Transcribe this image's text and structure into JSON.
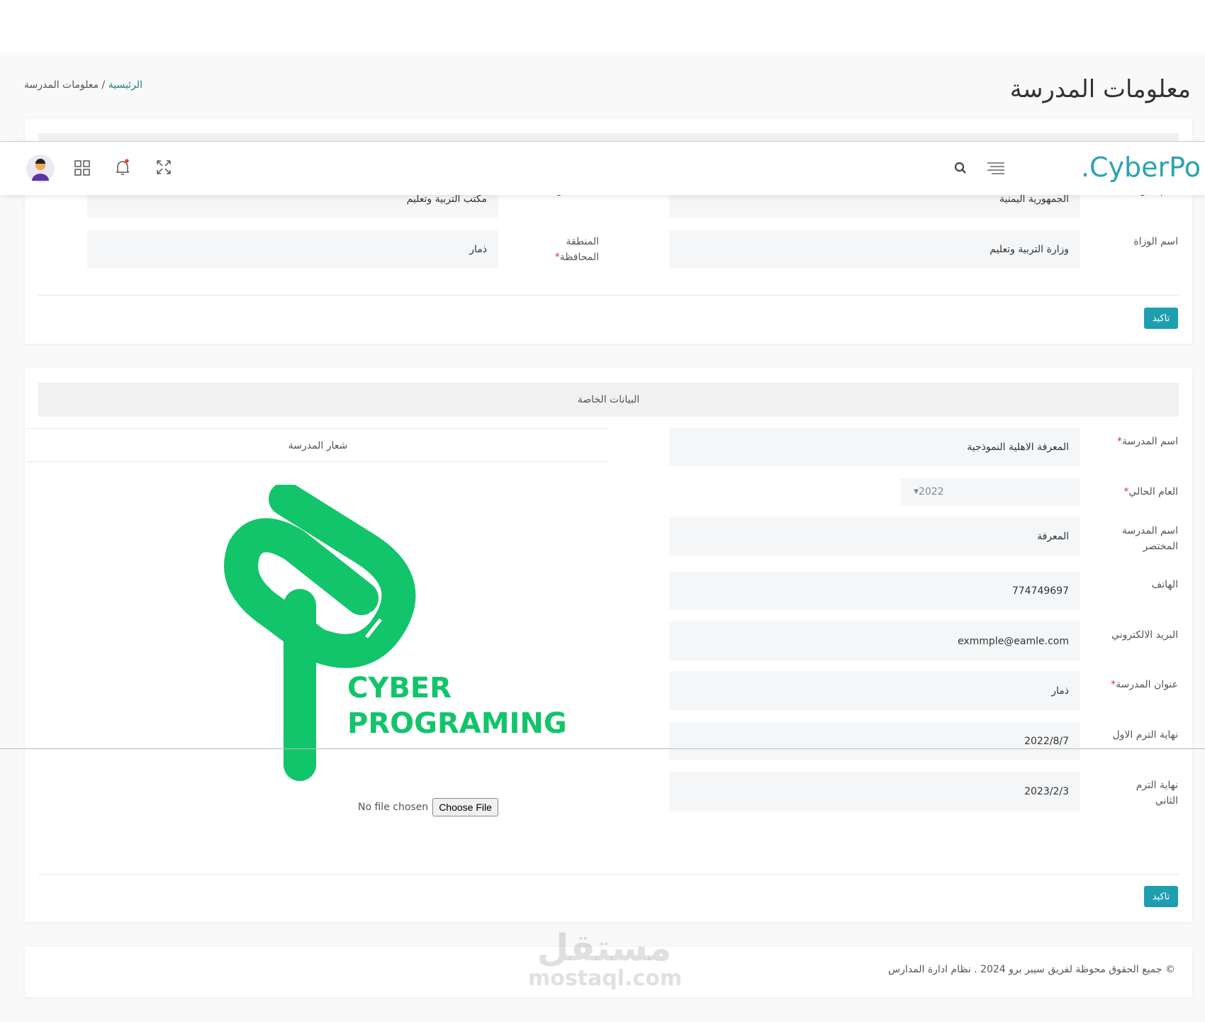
{
  "page": {
    "title": "معلومات المدرسة",
    "breadcrumb": [
      "الرئيسية",
      "معلومات المدرسة"
    ]
  },
  "navbar": {
    "brand": ".CyberPo"
  },
  "card1": {
    "fields": [
      {
        "label": "اسم الدولة",
        "value": "الجمهورية اليمنية"
      },
      {
        "label": "مكتب التربية",
        "value": "مكتب التربية وتعليم"
      },
      {
        "label": "اسم الوزاة",
        "value": "وزارة التربية وتعليم"
      },
      {
        "label": "المنطقة المحافظة",
        "value": "ذمار",
        "required": true
      }
    ],
    "confirm": "تاكيد"
  },
  "card2": {
    "header": "البيانات الخاصة",
    "logo_header": "شعار المدرسة",
    "logo_text": [
      "CYBER",
      "PROGRAMING"
    ],
    "file": {
      "status": "No file chosen",
      "button": "Choose File"
    },
    "fields": [
      {
        "label": "اسم المدرسة",
        "value": "المعرفة الاهلية النموذجية",
        "required": true
      },
      {
        "label": "العام الحالي",
        "value": "2022",
        "required": true,
        "type": "select"
      },
      {
        "label": "اسم المدرسة المختصر",
        "value": "المعرفة"
      },
      {
        "label": "الهاتف",
        "value": "774749697"
      },
      {
        "label": "البريد الالكتروني",
        "value": "exmmple@eamle.com"
      },
      {
        "label": "عنوان المدرسة",
        "value": "ذمار",
        "required": true
      },
      {
        "label": "نهاية الترم الاول",
        "value": "2022/8/7"
      },
      {
        "label": "نهاية الترم الثاني",
        "value": "2023/2/3"
      }
    ],
    "confirm": "تاكيد"
  },
  "footer": {
    "text": "© جميع الحقوق محوظة لفريق سيبر برو 2024 . نظام ادارة المدارس"
  },
  "watermark": {
    "ar": "مستقل",
    "en": "mostaql.com"
  },
  "colors": {
    "accent": "#1e9fb0",
    "logo": "#12c46a"
  }
}
